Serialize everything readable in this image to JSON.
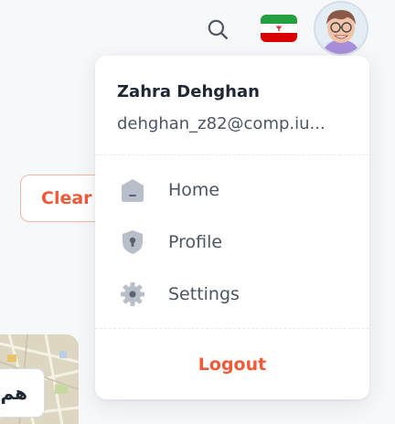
{
  "header": {
    "search_icon": "search-icon",
    "flag_icon": "iran-flag-icon",
    "avatar_icon": "user-avatar"
  },
  "background": {
    "clear_label": "Clear",
    "map_input_text": "هم"
  },
  "user": {
    "name": "Zahra Dehghan",
    "email": "dehghan_z82@comp.iu..."
  },
  "menu": {
    "items": [
      {
        "label": "Home",
        "icon": "home-icon"
      },
      {
        "label": "Profile",
        "icon": "shield-icon"
      },
      {
        "label": "Settings",
        "icon": "gear-icon"
      }
    ],
    "logout_label": "Logout"
  },
  "colors": {
    "accent": "#f05a38",
    "icon_gray": "#9aa3ae",
    "text": "#1f2733",
    "muted": "#4b5563",
    "flag_green": "#239f40",
    "flag_red": "#da0000"
  }
}
